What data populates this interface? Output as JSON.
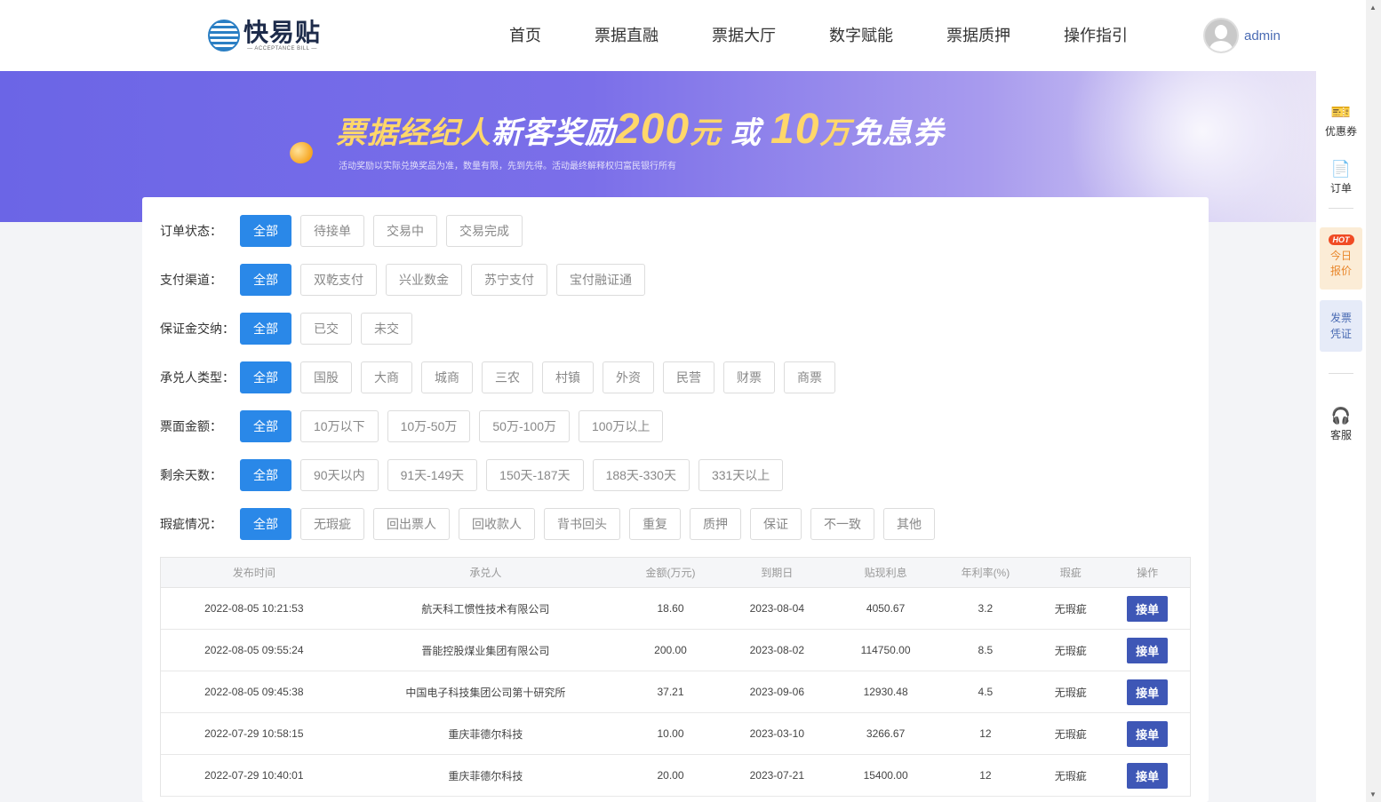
{
  "header": {
    "logo_text": "快易贴",
    "logo_sub": "— ACCEPTANCE BILL —",
    "nav": [
      "首页",
      "票据直融",
      "票据大厅",
      "数字赋能",
      "票据质押",
      "操作指引"
    ],
    "user_name": "admin"
  },
  "banner": {
    "title_part1": "票据经纪人",
    "title_part2": "新客奖励",
    "title_amount": "200",
    "title_unit1": "元 ",
    "title_or": "或 ",
    "title_amount2": "10",
    "title_unit2": "万",
    "title_part3": "免息券",
    "subtitle": "活动奖励以实际兑换奖品为准，数量有限，先到先得。活动最终解释权归富民银行所有"
  },
  "rightbar": {
    "coupon_label": "优惠券",
    "order_label": "订单",
    "hot_badge": "HOT",
    "today_label1": "今日",
    "today_label2": "报价",
    "invoice_label1": "发票",
    "invoice_label2": "凭证",
    "service_label": "客服"
  },
  "filters": [
    {
      "label": "订单状态：",
      "options": [
        "全部",
        "待接单",
        "交易中",
        "交易完成"
      ]
    },
    {
      "label": "支付渠道：",
      "options": [
        "全部",
        "双乾支付",
        "兴业数金",
        "苏宁支付",
        "宝付融证通"
      ]
    },
    {
      "label": "保证金交纳：",
      "options": [
        "全部",
        "已交",
        "未交"
      ]
    },
    {
      "label": "承兑人类型：",
      "options": [
        "全部",
        "国股",
        "大商",
        "城商",
        "三农",
        "村镇",
        "外资",
        "民营",
        "财票",
        "商票"
      ]
    },
    {
      "label": "票面金额：",
      "options": [
        "全部",
        "10万以下",
        "10万-50万",
        "50万-100万",
        "100万以上"
      ]
    },
    {
      "label": "剩余天数：",
      "options": [
        "全部",
        "90天以内",
        "91天-149天",
        "150天-187天",
        "188天-330天",
        "331天以上"
      ]
    },
    {
      "label": "瑕疵情况：",
      "options": [
        "全部",
        "无瑕疵",
        "回出票人",
        "回收款人",
        "背书回头",
        "重复",
        "质押",
        "保证",
        "不一致",
        "其他"
      ]
    }
  ],
  "table": {
    "headers": [
      "发布时间",
      "承兑人",
      "金额(万元)",
      "到期日",
      "贴现利息",
      "年利率(%)",
      "瑕疵",
      "操作"
    ],
    "rows": [
      [
        "2022-08-05 10:21:53",
        "航天科工惯性技术有限公司",
        "18.60",
        "2023-08-04",
        "4050.67",
        "3.2",
        "无瑕疵",
        "接单"
      ],
      [
        "2022-08-05 09:55:24",
        "晋能控股煤业集团有限公司",
        "200.00",
        "2023-08-02",
        "114750.00",
        "8.5",
        "无瑕疵",
        "接单"
      ],
      [
        "2022-08-05 09:45:38",
        "中国电子科技集团公司第十研究所",
        "37.21",
        "2023-09-06",
        "12930.48",
        "4.5",
        "无瑕疵",
        "接单"
      ],
      [
        "2022-07-29 10:58:15",
        "重庆菲德尔科技",
        "10.00",
        "2023-03-10",
        "3266.67",
        "12",
        "无瑕疵",
        "接单"
      ],
      [
        "2022-07-29 10:40:01",
        "重庆菲德尔科技",
        "20.00",
        "2023-07-21",
        "15400.00",
        "12",
        "无瑕疵",
        "接单"
      ]
    ]
  },
  "colors": {
    "primary_blue": "#2a88e8",
    "accept_button": "#3e57b6",
    "banner_purple": "#6b65e6"
  }
}
